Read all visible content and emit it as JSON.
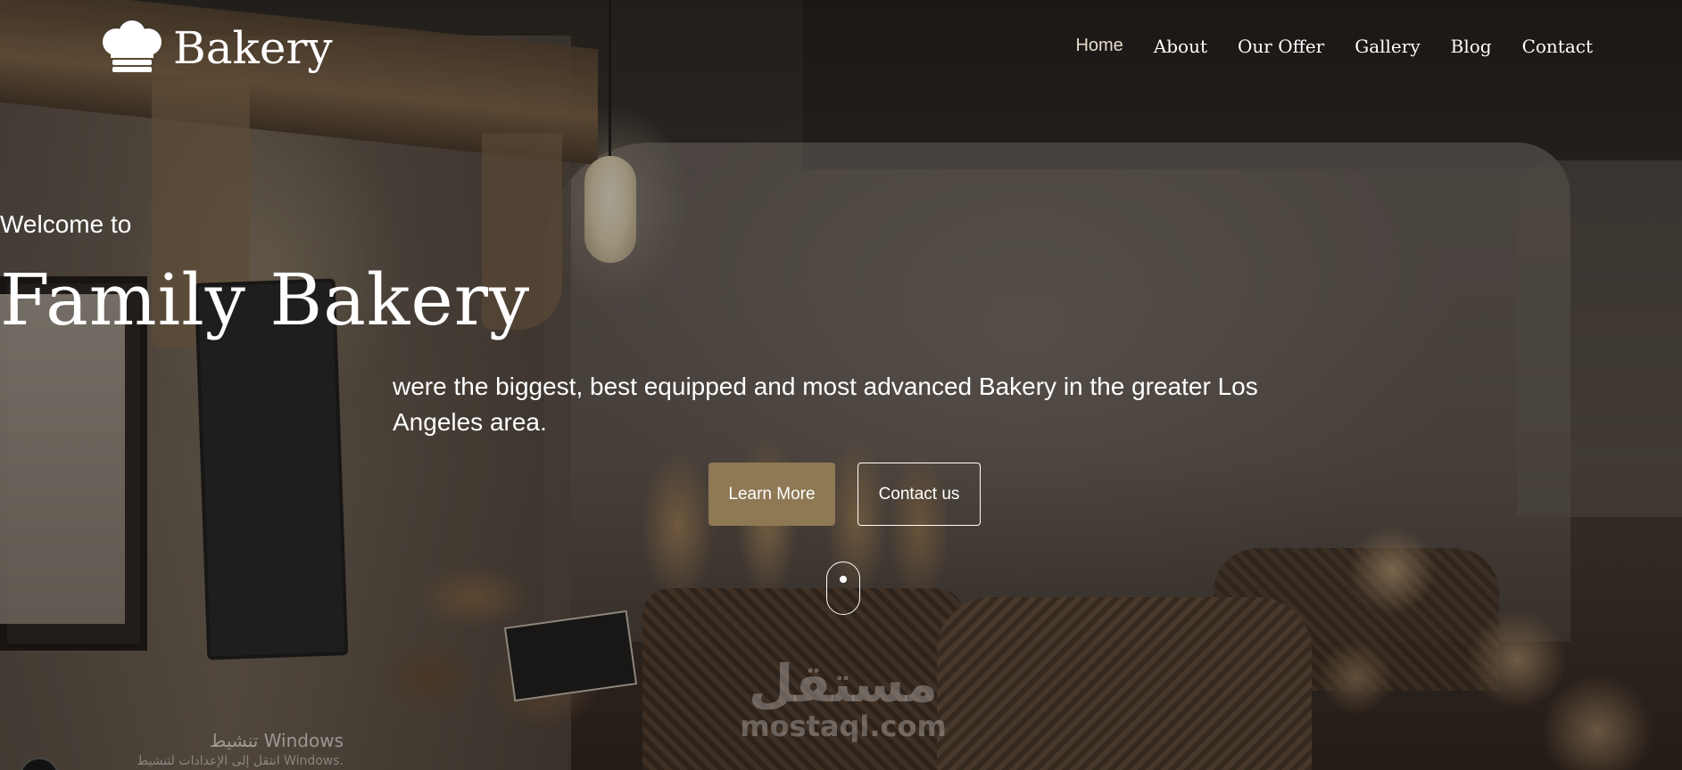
{
  "brand": {
    "name": "Bakery",
    "icon": "chef-hat-icon"
  },
  "nav": {
    "items": [
      {
        "label": "Home",
        "active": true
      },
      {
        "label": "About",
        "active": false
      },
      {
        "label": "Our Offer",
        "active": false
      },
      {
        "label": "Gallery",
        "active": false
      },
      {
        "label": "Blog",
        "active": false
      },
      {
        "label": "Contact",
        "active": false
      }
    ]
  },
  "hero": {
    "welcome": "Welcome to",
    "title": "Family Bakery",
    "subtitle": "were the biggest, best equipped and most advanced Bakery in the greater Los Angeles area.",
    "primary_button": "Learn More",
    "secondary_button": "Contact us",
    "scroll_icon": "mouse-scroll-icon"
  },
  "watermark": {
    "arabic": "مستقل",
    "latin": "mostaql.com"
  },
  "os_overlay": {
    "line1": "تنشيط Windows",
    "line2": "انتقل إلى الإعدادات لتنشيط Windows."
  },
  "colors": {
    "accent": "#8f7954",
    "text": "#ffffff",
    "nav_active": "#e6dccb"
  }
}
